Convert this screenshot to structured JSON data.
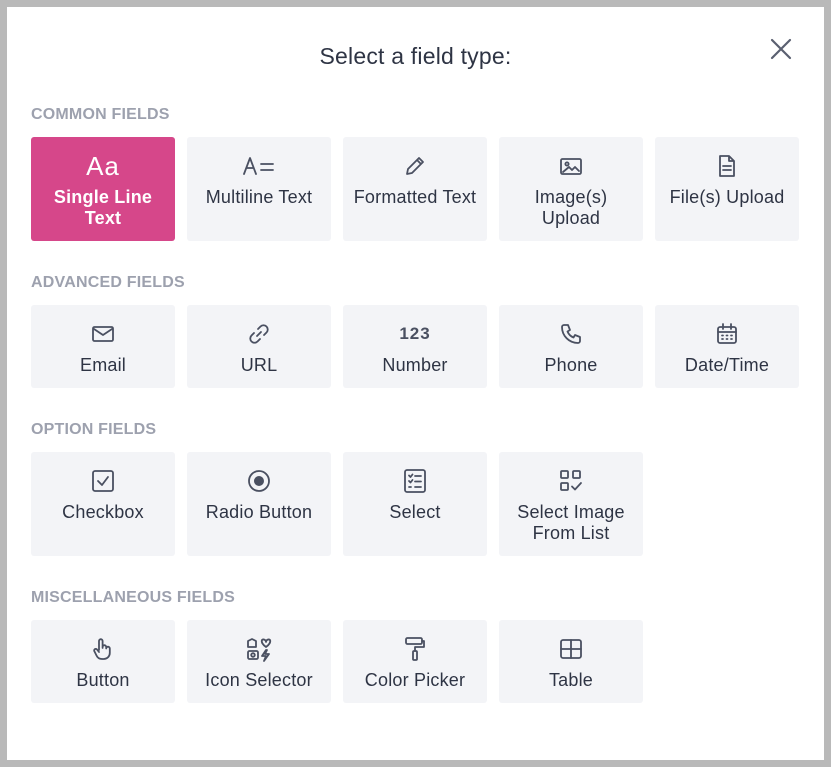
{
  "dialog": {
    "title": "Select a field type:",
    "close_icon": "close-icon"
  },
  "sections": [
    {
      "label": "COMMON FIELDS",
      "items": [
        {
          "label": "Single Line Text",
          "icon": "text-aa-icon",
          "glyph": "Aa",
          "selected": true
        },
        {
          "label": "Multiline Text",
          "icon": "text-lines-icon"
        },
        {
          "label": "Formatted Text",
          "icon": "pencil-icon"
        },
        {
          "label": "Image(s) Upload",
          "icon": "image-icon"
        },
        {
          "label": "File(s) Upload",
          "icon": "file-icon"
        }
      ]
    },
    {
      "label": "ADVANCED FIELDS",
      "items": [
        {
          "label": "Email",
          "icon": "envelope-icon"
        },
        {
          "label": "URL",
          "icon": "link-icon"
        },
        {
          "label": "Number",
          "icon": "number-icon",
          "glyph": "123"
        },
        {
          "label": "Phone",
          "icon": "phone-icon"
        },
        {
          "label": "Date/Time",
          "icon": "calendar-icon"
        }
      ]
    },
    {
      "label": "OPTION FIELDS",
      "items": [
        {
          "label": "Checkbox",
          "icon": "checkbox-icon"
        },
        {
          "label": "Radio Button",
          "icon": "radio-icon"
        },
        {
          "label": "Select",
          "icon": "select-list-icon"
        },
        {
          "label": "Select Image From List",
          "icon": "image-list-icon"
        }
      ]
    },
    {
      "label": "MISCELLANEOUS FIELDS",
      "items": [
        {
          "label": "Button",
          "icon": "pointer-hand-icon"
        },
        {
          "label": "Icon Selector",
          "icon": "icon-selector-icon"
        },
        {
          "label": "Color Picker",
          "icon": "paint-roller-icon"
        },
        {
          "label": "Table",
          "icon": "table-icon"
        }
      ]
    }
  ],
  "colors": {
    "accent": "#d6478a",
    "tile_bg": "#f3f4f7",
    "section_label": "#9da1ae",
    "text": "#2e3444"
  }
}
